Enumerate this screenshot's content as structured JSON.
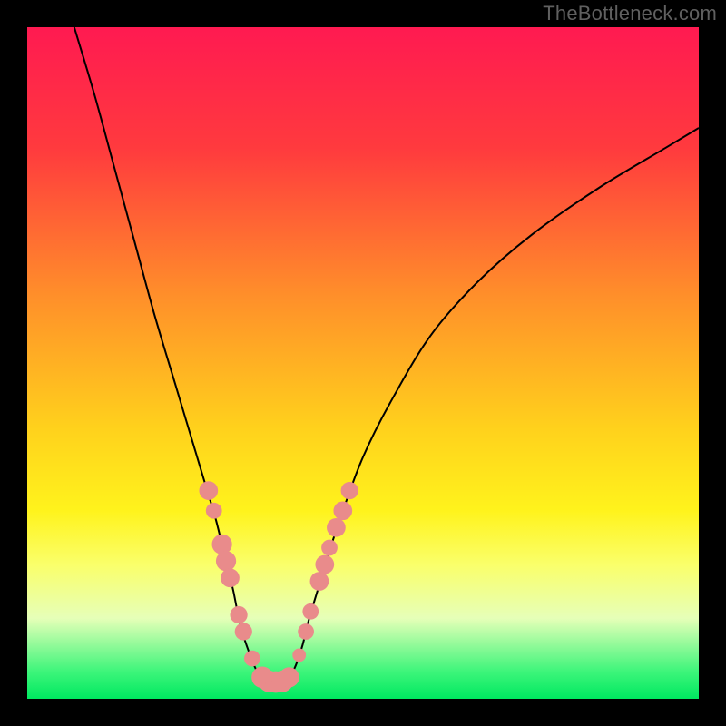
{
  "watermark": "TheBottleneck.com",
  "chart_data": {
    "type": "line",
    "title": "",
    "xlabel": "",
    "ylabel": "",
    "xlim": [
      0,
      100
    ],
    "ylim": [
      0,
      100
    ],
    "gradient_stops": [
      {
        "offset": 0,
        "color": "#ff1a51"
      },
      {
        "offset": 18,
        "color": "#ff3a3e"
      },
      {
        "offset": 40,
        "color": "#ff8f2a"
      },
      {
        "offset": 60,
        "color": "#ffd21c"
      },
      {
        "offset": 72,
        "color": "#fff31c"
      },
      {
        "offset": 80,
        "color": "#faff6a"
      },
      {
        "offset": 88,
        "color": "#e6ffb8"
      },
      {
        "offset": 96,
        "color": "#3cf57a"
      },
      {
        "offset": 100,
        "color": "#00e860"
      }
    ],
    "series": [
      {
        "name": "left-curve",
        "color": "#000000",
        "x": [
          7,
          10,
          13,
          16,
          19,
          22,
          25,
          26.5,
          28,
          29,
          30,
          30.7,
          31.3,
          32,
          33,
          34,
          35
        ],
        "y": [
          100,
          90,
          79,
          68,
          57,
          47,
          37,
          32,
          27,
          23,
          19,
          16,
          13,
          10,
          7,
          4.5,
          3
        ]
      },
      {
        "name": "right-curve",
        "color": "#000000",
        "x": [
          39,
          40,
          41,
          42,
          43.5,
          45,
          47,
          50,
          54,
          60,
          67,
          75,
          85,
          95,
          100
        ],
        "y": [
          3,
          5,
          8,
          12,
          17,
          22,
          28,
          36,
          44,
          54,
          62,
          69,
          76,
          82,
          85
        ]
      },
      {
        "name": "bottom-link",
        "color": "#000000",
        "x": [
          35,
          36,
          37,
          38,
          39
        ],
        "y": [
          3,
          2.5,
          2.4,
          2.5,
          3
        ]
      }
    ],
    "markers": {
      "name": "highlight-beads",
      "color": "#e98b8b",
      "radius_small": 1.0,
      "radius_large": 1.6,
      "points": [
        {
          "x": 27.0,
          "y": 31.0,
          "r": 1.4
        },
        {
          "x": 27.8,
          "y": 28.0,
          "r": 1.2
        },
        {
          "x": 29.0,
          "y": 23.0,
          "r": 1.5
        },
        {
          "x": 29.6,
          "y": 20.5,
          "r": 1.5
        },
        {
          "x": 30.2,
          "y": 18.0,
          "r": 1.4
        },
        {
          "x": 31.5,
          "y": 12.5,
          "r": 1.3
        },
        {
          "x": 32.2,
          "y": 10.0,
          "r": 1.3
        },
        {
          "x": 33.5,
          "y": 6.0,
          "r": 1.2
        },
        {
          "x": 35.0,
          "y": 3.2,
          "r": 1.6
        },
        {
          "x": 36.0,
          "y": 2.6,
          "r": 1.6
        },
        {
          "x": 37.0,
          "y": 2.5,
          "r": 1.6
        },
        {
          "x": 38.0,
          "y": 2.6,
          "r": 1.6
        },
        {
          "x": 39.0,
          "y": 3.2,
          "r": 1.5
        },
        {
          "x": 40.5,
          "y": 6.5,
          "r": 1.0
        },
        {
          "x": 41.5,
          "y": 10.0,
          "r": 1.2
        },
        {
          "x": 42.2,
          "y": 13.0,
          "r": 1.2
        },
        {
          "x": 43.5,
          "y": 17.5,
          "r": 1.4
        },
        {
          "x": 44.3,
          "y": 20.0,
          "r": 1.4
        },
        {
          "x": 45.0,
          "y": 22.5,
          "r": 1.2
        },
        {
          "x": 46.0,
          "y": 25.5,
          "r": 1.4
        },
        {
          "x": 47.0,
          "y": 28.0,
          "r": 1.4
        },
        {
          "x": 48.0,
          "y": 31.0,
          "r": 1.3
        }
      ]
    }
  }
}
